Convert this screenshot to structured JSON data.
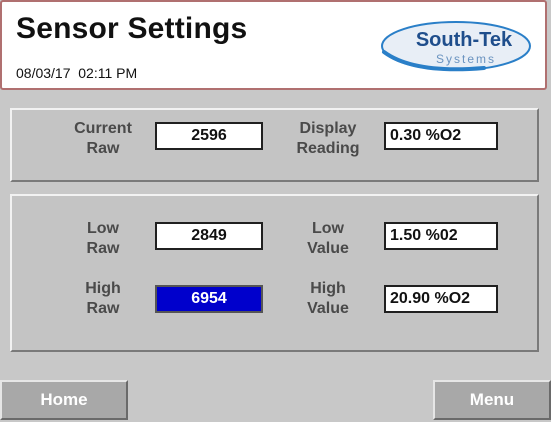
{
  "header": {
    "title": "Sensor Settings",
    "datetime": "08/03/17  02:11 PM",
    "logo": {
      "name": "South-Tek",
      "sub": "Systems"
    }
  },
  "current": {
    "raw_label": [
      "Current",
      "Raw"
    ],
    "raw_value": "2596",
    "display_label": [
      "Display",
      "Reading"
    ],
    "display_value": "0.30 %O2"
  },
  "calibration": {
    "low_raw_label": [
      "Low",
      "Raw"
    ],
    "low_raw_value": "2849",
    "low_value_label": [
      "Low",
      "Value"
    ],
    "low_value": "1.50 %02",
    "high_raw_label": [
      "High",
      "Raw"
    ],
    "high_raw_value": "6954",
    "high_value_label": [
      "High",
      "Value"
    ],
    "high_value": "20.90 %O2"
  },
  "nav": {
    "home": "Home",
    "menu": "Menu"
  },
  "colors": {
    "selected_field": "#0000cc",
    "header_border": "#b07070",
    "logo_blue": "#2a7fc8"
  }
}
